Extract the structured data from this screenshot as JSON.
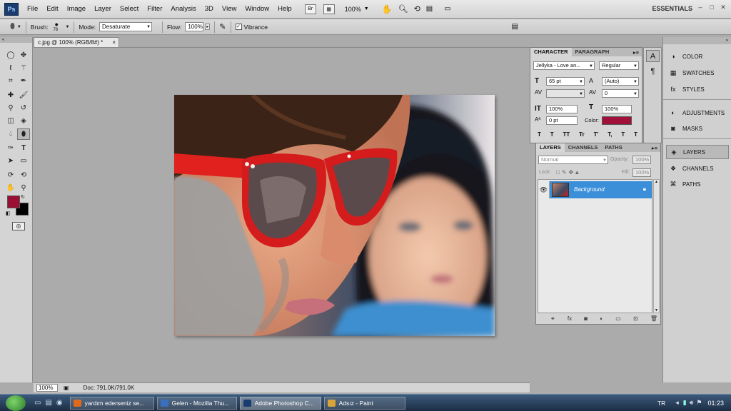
{
  "menubar": {
    "logo": "Ps",
    "items": [
      "File",
      "Edit",
      "Image",
      "Layer",
      "Select",
      "Filter",
      "Analysis",
      "3D",
      "View",
      "Window",
      "Help"
    ],
    "bridge_icon": "Br",
    "zoom": "100%",
    "workspace": "ESSENTIALS"
  },
  "options": {
    "brush_label": "Brush:",
    "brush_size": "78",
    "mode_label": "Mode:",
    "mode_value": "Desaturate",
    "flow_label": "Flow:",
    "flow_value": "100%",
    "vibrance_label": "Vibrance",
    "vibrance_checked": true
  },
  "document": {
    "tab_title": "c.jpg @ 100% (RGB/8#) *",
    "zoom": "100%",
    "doc_info": "Doc: 791.0K/791.0K"
  },
  "colors": {
    "foreground": "#9a0f33",
    "background": "#000000",
    "accent": "#3b8fd9"
  },
  "character_panel": {
    "tabs": [
      "CHARACTER",
      "PARAGRAPH"
    ],
    "font_family": "Jellyka - Love an...",
    "font_style": "Regular",
    "font_size": "65 pt",
    "leading": "(Auto)",
    "kerning": "",
    "tracking": "0",
    "vertical_scale": "100%",
    "horizontal_scale": "100%",
    "baseline_shift": "0 pt",
    "color_label": "Color:",
    "color_value": "#a0103a",
    "style_buttons": [
      "T",
      "T",
      "TT",
      "Tr",
      "T'",
      "T,",
      "T",
      "T"
    ]
  },
  "layers_panel": {
    "tabs": [
      "LAYERS",
      "CHANNELS",
      "PATHS"
    ],
    "blend_mode": "Normal",
    "opacity_label": "Opacity:",
    "opacity": "100%",
    "lock_label": "Lock:",
    "fill_label": "Fill:",
    "fill": "100%",
    "layers": [
      {
        "name": "Background",
        "visible": true,
        "selected": true,
        "locked": true
      }
    ]
  },
  "dock": {
    "items": [
      "COLOR",
      "SWATCHES",
      "STYLES",
      "ADJUSTMENTS",
      "MASKS",
      "LAYERS",
      "CHANNELS",
      "PATHS"
    ]
  },
  "taskbar": {
    "tasks": [
      {
        "label": "yardım ederseniz se...",
        "icon": "firefox-icon"
      },
      {
        "label": "Gelen - Mozilla Thu...",
        "icon": "thunderbird-icon"
      },
      {
        "label": "Adobe Photoshop C...",
        "icon": "photoshop-icon"
      },
      {
        "label": "Adsız - Paint",
        "icon": "paint-icon"
      }
    ],
    "language": "TR",
    "clock": "01:23"
  }
}
